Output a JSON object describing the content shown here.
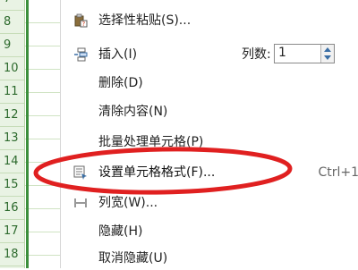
{
  "row_numbers": [
    "7",
    "8",
    "9",
    "10",
    "11",
    "12",
    "13",
    "14",
    "15",
    "16",
    "17",
    "18",
    "19"
  ],
  "menu": {
    "paste_special": "选择性粘贴(S)...",
    "insert": "插入(I)",
    "columns_label": "列数:",
    "columns_value": "1",
    "delete": "删除(D)",
    "clear_contents": "清除内容(N)",
    "batch_process": "批量处理单元格(P)",
    "format_cells": "设置单元格格式(F)...",
    "format_cells_shortcut": "Ctrl+1",
    "column_width": "列宽(W)...",
    "hide": "隐藏(H)",
    "unhide": "取消隐藏(U)"
  },
  "colors": {
    "highlight_ellipse": "#e02020",
    "row_header_bg": "#e9f3e4",
    "row_header_text": "#2d6a2d",
    "column_border": "#3c8f3c"
  },
  "icons": {
    "paste_special": "clipboard-paste-icon",
    "insert": "insert-rows-icon",
    "format_cells": "format-cells-icon",
    "column_width": "column-width-icon"
  }
}
